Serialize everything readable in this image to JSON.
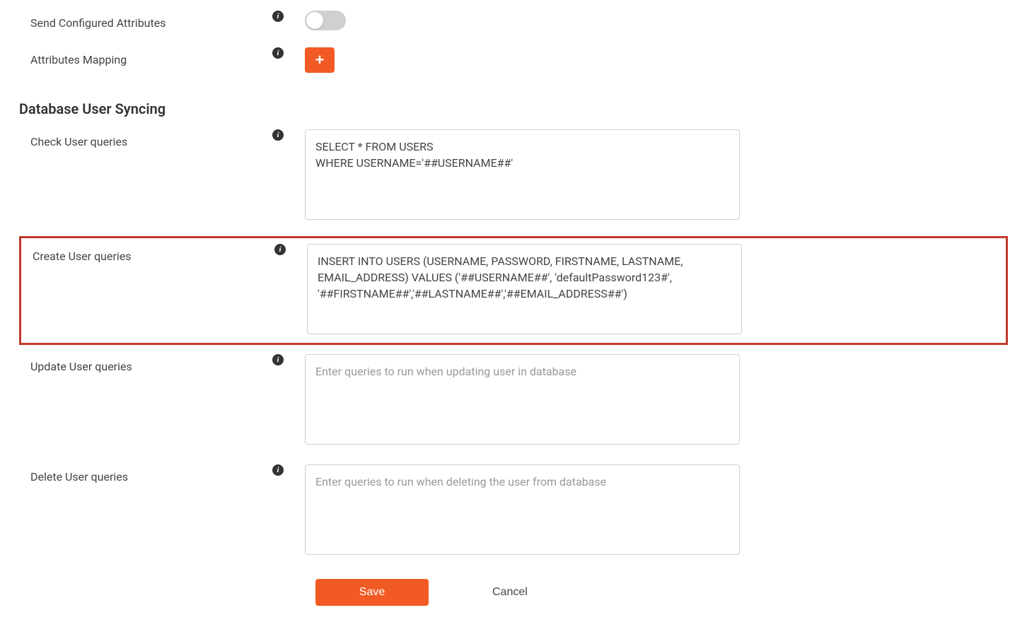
{
  "labels": {
    "send_configured_attributes": "Send Configured Attributes",
    "attributes_mapping": "Attributes Mapping",
    "check_user_queries": "Check User queries",
    "create_user_queries": "Create User queries",
    "update_user_queries": "Update User queries",
    "delete_user_queries": "Delete User queries"
  },
  "section": {
    "db_user_syncing": "Database User Syncing"
  },
  "queries": {
    "check": "SELECT * FROM USERS\nWHERE USERNAME='##USERNAME##'",
    "create": "INSERT INTO USERS (USERNAME, PASSWORD, FIRSTNAME, LASTNAME, EMAIL_ADDRESS) VALUES ('##USERNAME##', 'defaultPassword123#', '##FIRSTNAME##','##LASTNAME##','##EMAIL_ADDRESS##')",
    "update": "",
    "delete": ""
  },
  "placeholders": {
    "update": "Enter queries to run when updating user in database",
    "delete": "Enter queries to run when deleting the user from database"
  },
  "buttons": {
    "save": "Save",
    "cancel": "Cancel",
    "add": "+"
  },
  "icons": {
    "info": "i"
  }
}
